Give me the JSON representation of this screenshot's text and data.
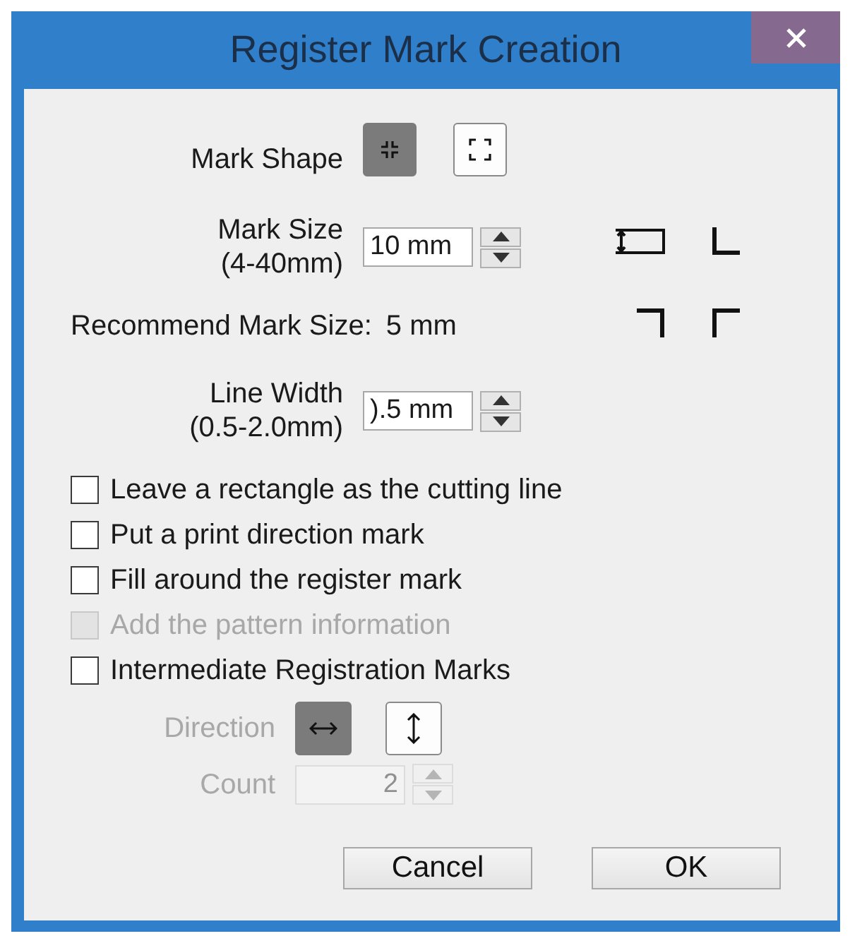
{
  "window": {
    "title": "Register Mark Creation"
  },
  "mark_shape": {
    "label": "Mark Shape",
    "options": [
      {
        "kind": "inner",
        "selected": true
      },
      {
        "kind": "outer",
        "selected": false
      }
    ]
  },
  "mark_size": {
    "label": "Mark Size",
    "range": "(4-40mm)",
    "value": "10 mm"
  },
  "recommend": {
    "label": "Recommend Mark Size:",
    "value": "5 mm"
  },
  "line_width": {
    "label": "Line Width",
    "range": "(0.5-2.0mm)",
    "value": ").5 mm"
  },
  "options": [
    {
      "label": "Leave a rectangle as the cutting line",
      "checked": false,
      "disabled": false
    },
    {
      "label": "Put a print direction mark",
      "checked": false,
      "disabled": false
    },
    {
      "label": "Fill around the register mark",
      "checked": false,
      "disabled": false
    },
    {
      "label": "Add the pattern information",
      "checked": false,
      "disabled": true
    },
    {
      "label": "Intermediate Registration Marks",
      "checked": false,
      "disabled": false
    }
  ],
  "direction": {
    "label": "Direction",
    "disabled": true,
    "options": [
      {
        "kind": "horizontal",
        "selected": true
      },
      {
        "kind": "vertical",
        "selected": false
      }
    ]
  },
  "count": {
    "label": "Count",
    "value": "2",
    "disabled": true
  },
  "buttons": [
    "Cancel",
    "OK"
  ]
}
